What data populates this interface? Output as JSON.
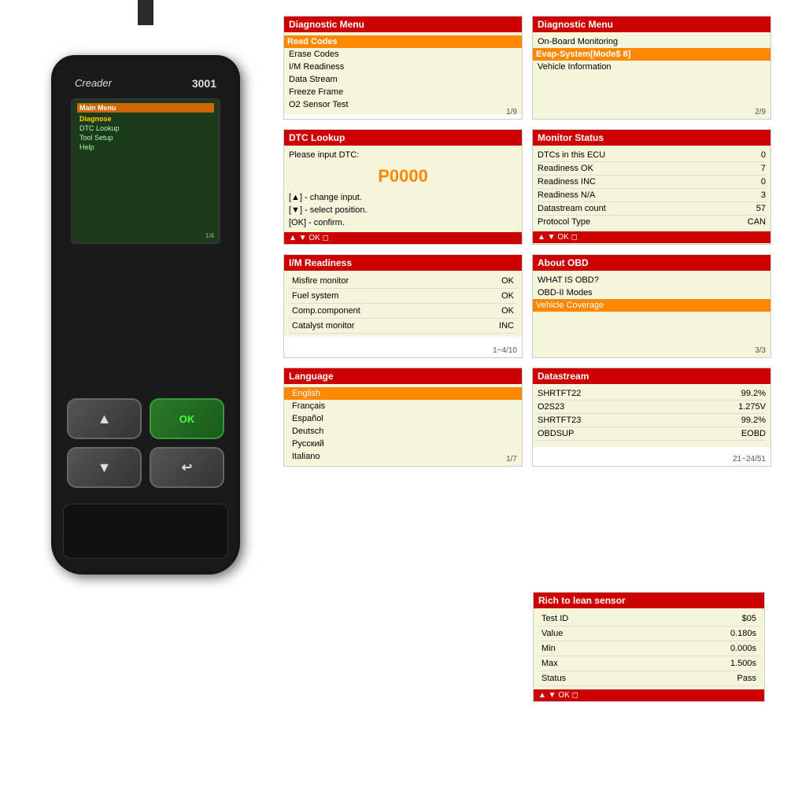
{
  "device": {
    "brand": "Creader",
    "model": "3001",
    "screen": {
      "title": "Main Menu",
      "items": [
        {
          "label": "Diagnose",
          "selected": true
        },
        {
          "label": "DTC Lookup",
          "selected": false
        },
        {
          "label": "Tool Setup",
          "selected": false
        },
        {
          "label": "Help",
          "selected": false
        }
      ],
      "page": "1/4"
    },
    "buttons": {
      "up": "▲",
      "ok": "OK",
      "down": "▼",
      "back": "↩"
    }
  },
  "panels": {
    "diagnostic_menu_1": {
      "title": "Diagnostic Menu",
      "items": [
        {
          "label": "Read Codes",
          "selected": true
        },
        {
          "label": "Erase Codes",
          "selected": false
        },
        {
          "label": "I/M Readiness",
          "selected": false
        },
        {
          "label": "Data Stream",
          "selected": false
        },
        {
          "label": "Freeze Frame",
          "selected": false
        },
        {
          "label": "O2 Sensor Test",
          "selected": false
        }
      ],
      "page": "1/9"
    },
    "diagnostic_menu_2": {
      "title": "Diagnostic Menu",
      "items": [
        {
          "label": "On-Board Monitoring",
          "selected": false
        },
        {
          "label": "Evap-System[Mode$ 8]",
          "selected": true
        },
        {
          "label": "Vehicle Information",
          "selected": false
        }
      ],
      "page": "2/9"
    },
    "dtc_lookup": {
      "title": "DTC Lookup",
      "prompt": "Please input DTC:",
      "value": "P0000",
      "hints": [
        "[▲] - change input.",
        "[▼] - select position.",
        "[OK] - confirm."
      ]
    },
    "monitor_status": {
      "title": "Monitor Status",
      "rows": [
        {
          "label": "DTCs in this ECU",
          "value": "0"
        },
        {
          "label": "Readiness OK",
          "value": "7"
        },
        {
          "label": "Readiness INC",
          "value": "0"
        },
        {
          "label": "Readiness N/A",
          "value": "3"
        },
        {
          "label": "Datastream count",
          "value": "57"
        },
        {
          "label": "Protocol Type",
          "value": "CAN"
        }
      ],
      "nav": "▲ ▼ OK ◻"
    },
    "im_readiness": {
      "title": "I/M Readiness",
      "rows": [
        {
          "label": "Misfire monitor",
          "value": "OK"
        },
        {
          "label": "Fuel system",
          "value": "OK"
        },
        {
          "label": "Comp.component",
          "value": "OK"
        },
        {
          "label": "Catalyst monitor",
          "value": "INC"
        }
      ],
      "page": "1~4/10"
    },
    "about_obd": {
      "title": "About OBD",
      "items": [
        {
          "label": "WHAT IS OBD?",
          "selected": false
        },
        {
          "label": "OBD-II Modes",
          "selected": false
        },
        {
          "label": "Vehicle Coverage",
          "selected": true
        }
      ],
      "page": "3/3"
    },
    "language": {
      "title": "Language",
      "items": [
        {
          "label": "English",
          "selected": true
        },
        {
          "label": "Français",
          "selected": false
        },
        {
          "label": "Español",
          "selected": false
        },
        {
          "label": "Deutsch",
          "selected": false
        },
        {
          "label": "Русский",
          "selected": false
        },
        {
          "label": "Italiano",
          "selected": false
        }
      ],
      "page": "1/7"
    },
    "datastream": {
      "title": "Datastream",
      "rows": [
        {
          "label": "SHRTFT22",
          "value": "99.2%"
        },
        {
          "label": "O2S23",
          "value": "1.275V"
        },
        {
          "label": "SHRTFT23",
          "value": "99.2%"
        },
        {
          "label": "OBDSUP",
          "value": "EOBD"
        }
      ],
      "page": "21~24/51"
    },
    "rich_lean": {
      "title": "Rich to lean sensor",
      "rows": [
        {
          "label": "Test ID",
          "value": "$05"
        },
        {
          "label": "Value",
          "value": "0.180s"
        },
        {
          "label": "Min",
          "value": "0.000s"
        },
        {
          "label": "Max",
          "value": "1.500s"
        },
        {
          "label": "Status",
          "value": "Pass"
        }
      ],
      "nav": "▲ ▼ OK ◻"
    }
  }
}
